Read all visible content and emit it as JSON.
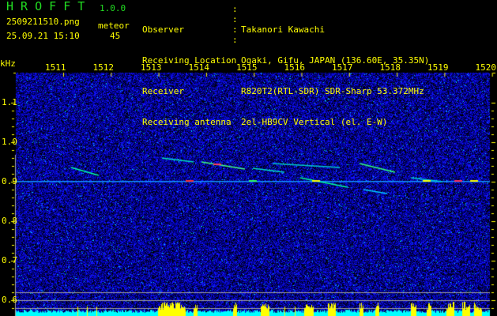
{
  "header": {
    "logo": "H R O F F T",
    "version": "1.0.0",
    "filename": "2509211510.png",
    "datetime": "25.09.21 15:10",
    "meteor_label": "meteor",
    "meteor_count": "45"
  },
  "info": [
    {
      "label": "Observer",
      "value": "Takanori Kawachi"
    },
    {
      "label": "Receiving Location",
      "value": "Ogaki, Gifu, JAPAN (136.60E, 35.35N)"
    },
    {
      "label": "Receiver",
      "value": "R820T2(RTL-SDR) SDR-Sharp 53.372MHz"
    },
    {
      "label": "Receiving antenna",
      "value": "2el-HB9CV Vertical (el. E-W)"
    }
  ],
  "axes": {
    "y_unit": "kHz",
    "x_ticks": [
      "1511",
      "1512",
      "1513",
      "1514",
      "1515",
      "1516",
      "1517",
      "1518",
      "1519",
      "1520"
    ],
    "y_ticks": [
      "1.1",
      "1.0",
      "0.9",
      "0.8",
      "0.7",
      "0.6"
    ]
  },
  "colors": {
    "text": "#ffff00",
    "logo": "#22dd22",
    "noise": "#0000cc",
    "baseline": "#00ffff"
  }
}
